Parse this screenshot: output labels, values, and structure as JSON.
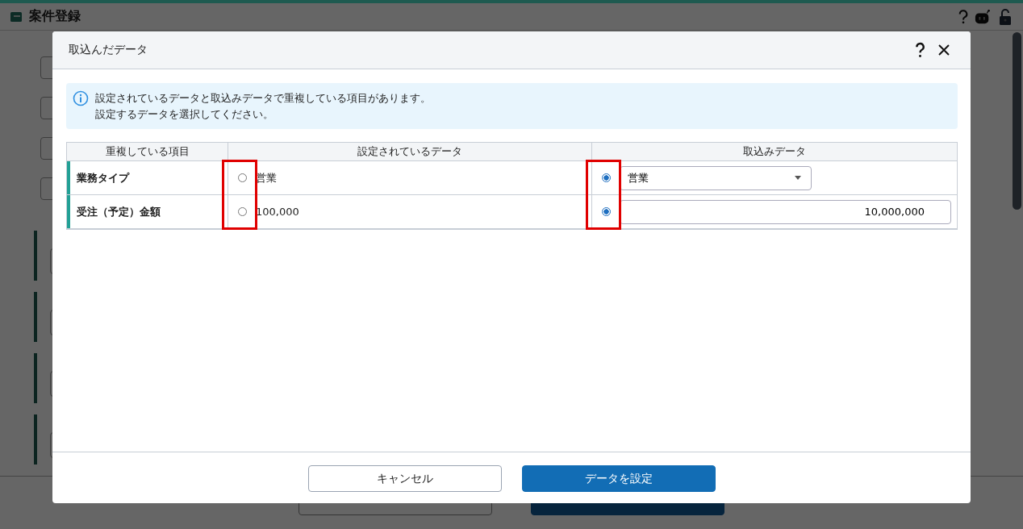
{
  "page": {
    "title": "案件登録"
  },
  "dialog": {
    "title": "取込んだデータ",
    "info": [
      "設定されているデータと取込みデータで重複している項目があります。",
      "設定するデータを選択してください。"
    ],
    "table": {
      "columns": [
        {
          "label": "重複している項目",
          "highlighted": false
        },
        {
          "label": "設定されているデータ",
          "highlighted": true
        },
        {
          "label": "取込みデータ",
          "highlighted": true
        }
      ],
      "rows": [
        {
          "item": "業務タイプ",
          "current": {
            "value": "営業",
            "selected": false
          },
          "imported": {
            "kind": "select",
            "value": "営業",
            "selected": true
          }
        },
        {
          "item": "受注（予定）金額",
          "current": {
            "value": "100,000",
            "selected": false
          },
          "imported": {
            "kind": "number",
            "value": "10,000,000",
            "selected": true
          }
        }
      ]
    },
    "buttons": [
      {
        "label": "キャンセル",
        "kind": "secondary"
      },
      {
        "label": "データを設定",
        "kind": "primary"
      }
    ]
  }
}
